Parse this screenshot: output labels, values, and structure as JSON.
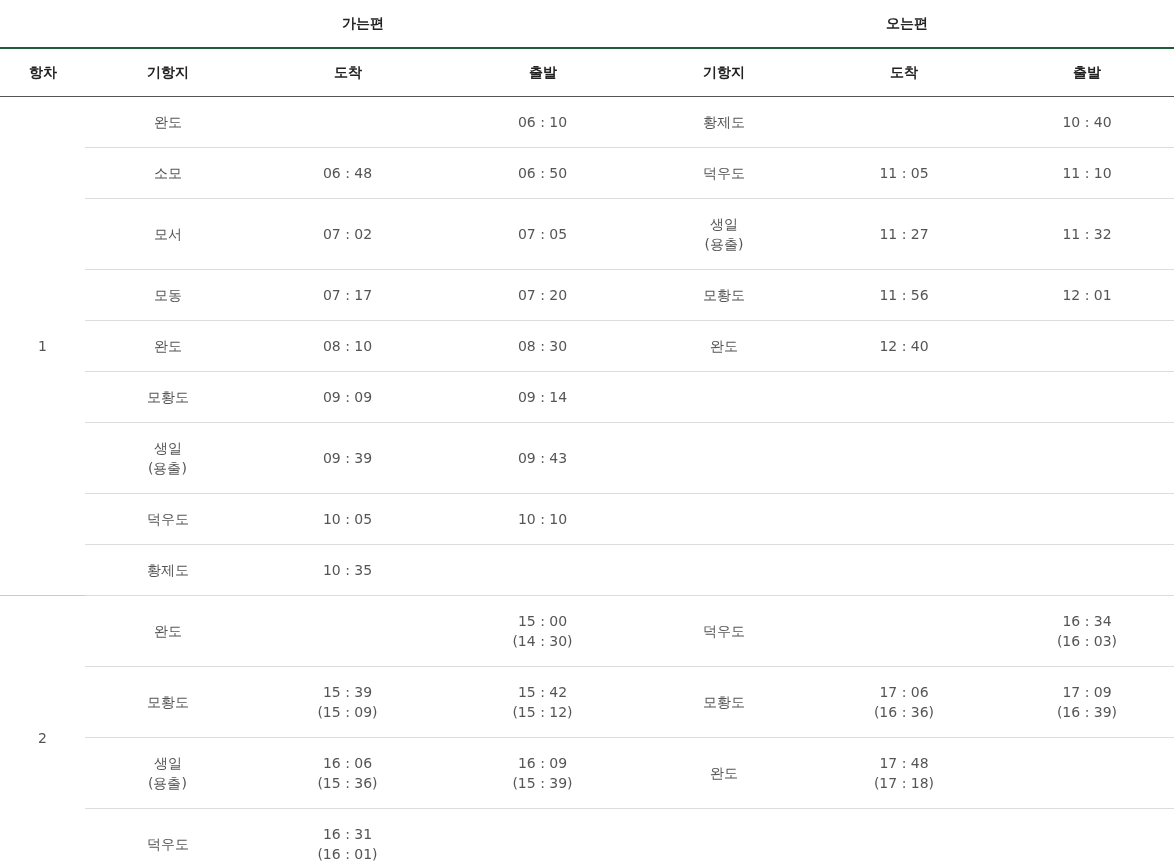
{
  "table": {
    "groups": [
      "가는편",
      "오는편"
    ],
    "columns": [
      "항차",
      "기항지",
      "도착",
      "출발",
      "기항지",
      "도착",
      "출발"
    ],
    "voyages": [
      {
        "number": "1",
        "rows": [
          [
            "완도",
            null,
            "06 : 10",
            "황제도",
            null,
            "10 : 40"
          ],
          [
            "소모",
            "06 : 48",
            "06 : 50",
            "덕우도",
            "11 : 05",
            "11 : 10"
          ],
          [
            "모서",
            "07 : 02",
            "07 : 05",
            "생일\n(용출)",
            "11 : 27",
            "11 : 32"
          ],
          [
            "모동",
            "07 : 17",
            "07 : 20",
            "모황도",
            "11 : 56",
            "12 : 01"
          ],
          [
            "완도",
            "08 : 10",
            "08 : 30",
            "완도",
            "12 : 40",
            null
          ],
          [
            "모황도",
            "09 : 09",
            "09 : 14",
            null,
            null,
            null
          ],
          [
            "생일\n(용출)",
            "09 : 39",
            "09 : 43",
            null,
            null,
            null
          ],
          [
            "덕우도",
            "10 : 05",
            "10 : 10",
            null,
            null,
            null
          ],
          [
            "황제도",
            "10 : 35",
            null,
            null,
            null,
            null
          ]
        ]
      },
      {
        "number": "2",
        "rows": [
          [
            "완도",
            null,
            "15 : 00\n(14 : 30)",
            "덕우도",
            null,
            "16 : 34\n(16 : 03)"
          ],
          [
            "모황도",
            "15 : 39\n(15 : 09)",
            "15 : 42\n(15 : 12)",
            "모황도",
            "17 : 06\n(16 : 36)",
            "17 : 09\n(16 : 39)"
          ],
          [
            "생일\n(용출)",
            "16 : 06\n(15 : 36)",
            "16 : 09\n(15 : 39)",
            "완도",
            "17 : 48\n(17 : 18)",
            null
          ],
          [
            "덕우도",
            "16 : 31\n(16 : 01)",
            null,
            null,
            null,
            null
          ]
        ]
      }
    ]
  }
}
